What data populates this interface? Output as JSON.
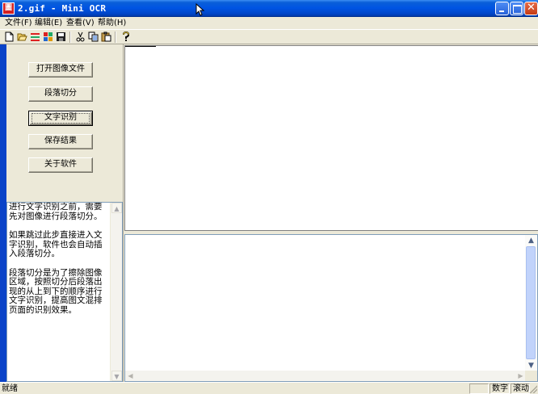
{
  "window": {
    "title": "2.gif - Mini OCR",
    "app_icon_glyph": "圖"
  },
  "menu": [
    {
      "label": "文件(F)"
    },
    {
      "label": "编辑(E)"
    },
    {
      "label": "查看(V)"
    },
    {
      "label": "帮助(H)"
    }
  ],
  "toolbar": {
    "icons": [
      "new-file-icon",
      "open-folder-icon",
      "cut-segment-icon",
      "recognize-icon",
      "save-icon",
      "cut-icon",
      "copy-icon",
      "paste-icon",
      "help-icon"
    ]
  },
  "buttons": {
    "open_image": "打开图像文件",
    "segment": "段落切分",
    "recognize": "文字识别",
    "save_result": "保存结果",
    "about": "关于软件"
  },
  "help_text": {
    "p1": "  进行文字识别之前，需要先对图像进行段落切分。",
    "p2": "  如果跳过此步直接进入文字识别，软件也会自动插入段落切分。",
    "p3": "  段落切分是为了擦除图像区域，按照切分后段落出现的从上到下的顺序进行文字识别，提高图文混排页面的识别效果。"
  },
  "statusbar": {
    "status": "就绪",
    "num_lock": "数字",
    "scroll_lock": "滚动"
  },
  "colors": {
    "titlebar": "#0054e3",
    "frame": "#0a43c8",
    "face": "#ece9d8"
  }
}
